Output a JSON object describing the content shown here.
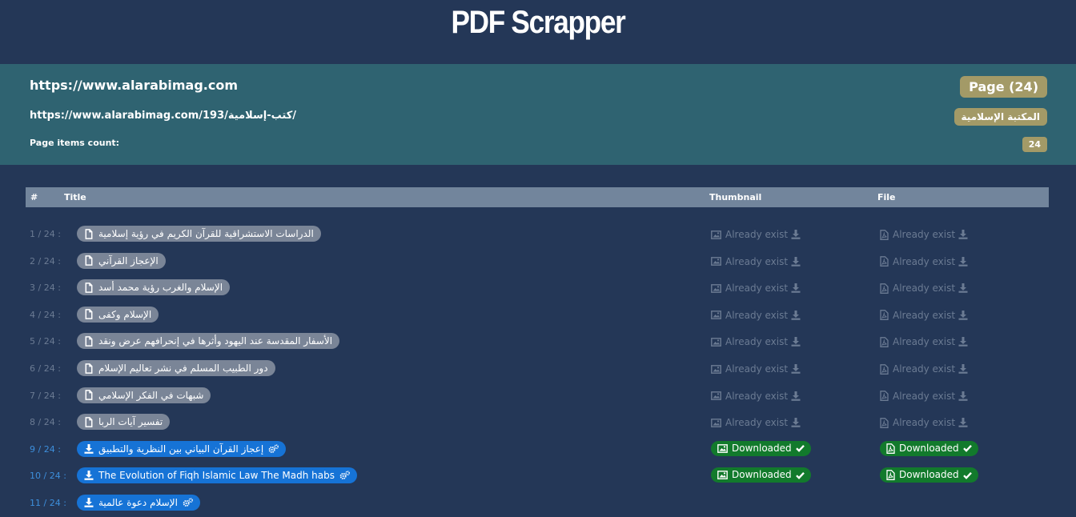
{
  "app": {
    "title": "PDF Scrapper"
  },
  "info": {
    "site_url": "https://www.alarabimag.com",
    "category_url": "https://www.alarabimag.com/193/كتب-إسلامية/",
    "items_count_label": "Page items count:",
    "page_badge": "Page (24)",
    "category_badge": "المكتبة الإسلامية",
    "count_badge": "24"
  },
  "table": {
    "headers": {
      "num": "#",
      "title": "Title",
      "thumbnail": "Thumbnail",
      "file": "File"
    },
    "rows": [
      {
        "index": "1 / 24 :",
        "title": "الدراسات الاستشراقية للقرآن الكريم في رؤية إسلامية",
        "thumb": "Already exist",
        "file": "Already exist",
        "status": "exists"
      },
      {
        "index": "2 / 24 :",
        "title": "الإعجاز القرآني",
        "thumb": "Already exist",
        "file": "Already exist",
        "status": "exists"
      },
      {
        "index": "3 / 24 :",
        "title": "الإسلام والغرب رؤية محمد أسد",
        "thumb": "Already exist",
        "file": "Already exist",
        "status": "exists"
      },
      {
        "index": "4 / 24 :",
        "title": "الإسلام وكفى",
        "thumb": "Already exist",
        "file": "Already exist",
        "status": "exists"
      },
      {
        "index": "5 / 24 :",
        "title": "الأسفار المقدسة عند اليهود وأثرها في إنحرافهم عرض ونقد",
        "thumb": "Already exist",
        "file": "Already exist",
        "status": "exists"
      },
      {
        "index": "6 / 24 :",
        "title": "دور الطبيب المسلم في نشر تعاليم الإسلام",
        "thumb": "Already exist",
        "file": "Already exist",
        "status": "exists"
      },
      {
        "index": "7 / 24 :",
        "title": "شبهات في الفكر الإسلامي",
        "thumb": "Already exist",
        "file": "Already exist",
        "status": "exists"
      },
      {
        "index": "8 / 24 :",
        "title": "تفسير آيات الربا",
        "thumb": "Already exist",
        "file": "Already exist",
        "status": "exists"
      },
      {
        "index": "9 / 24 :",
        "title": "إعجاز القرآن البياني بين النظرية والتطبيق",
        "thumb": "Downloaded",
        "file": "Downloaded",
        "status": "downloaded"
      },
      {
        "index": "10 / 24 :",
        "title": "The Evolution of Fiqh Islamic Law The Madh habs",
        "thumb": "Downloaded",
        "file": "Downloaded",
        "status": "downloaded"
      },
      {
        "index": "11 / 24 :",
        "title": "الإسلام دعوة عالمية",
        "thumb": "",
        "file": "",
        "status": "processing"
      }
    ]
  },
  "colors": {
    "background": "#243757",
    "info_panel": "#2f6371",
    "badge": "#a39a67",
    "table_header": "#72859c",
    "pill_done": "#7a8597",
    "pill_active": "#1673d6",
    "downloaded": "#127a2c",
    "muted": "#6b7b93"
  },
  "icons": {
    "title_done": "file-icon",
    "title_active": "download-icon",
    "title_active_extra": "cogs-icon",
    "thumb": "image-icon",
    "file": "pdf-file-icon",
    "exists_action": "download-icon",
    "downloaded_mark": "check-icon"
  }
}
